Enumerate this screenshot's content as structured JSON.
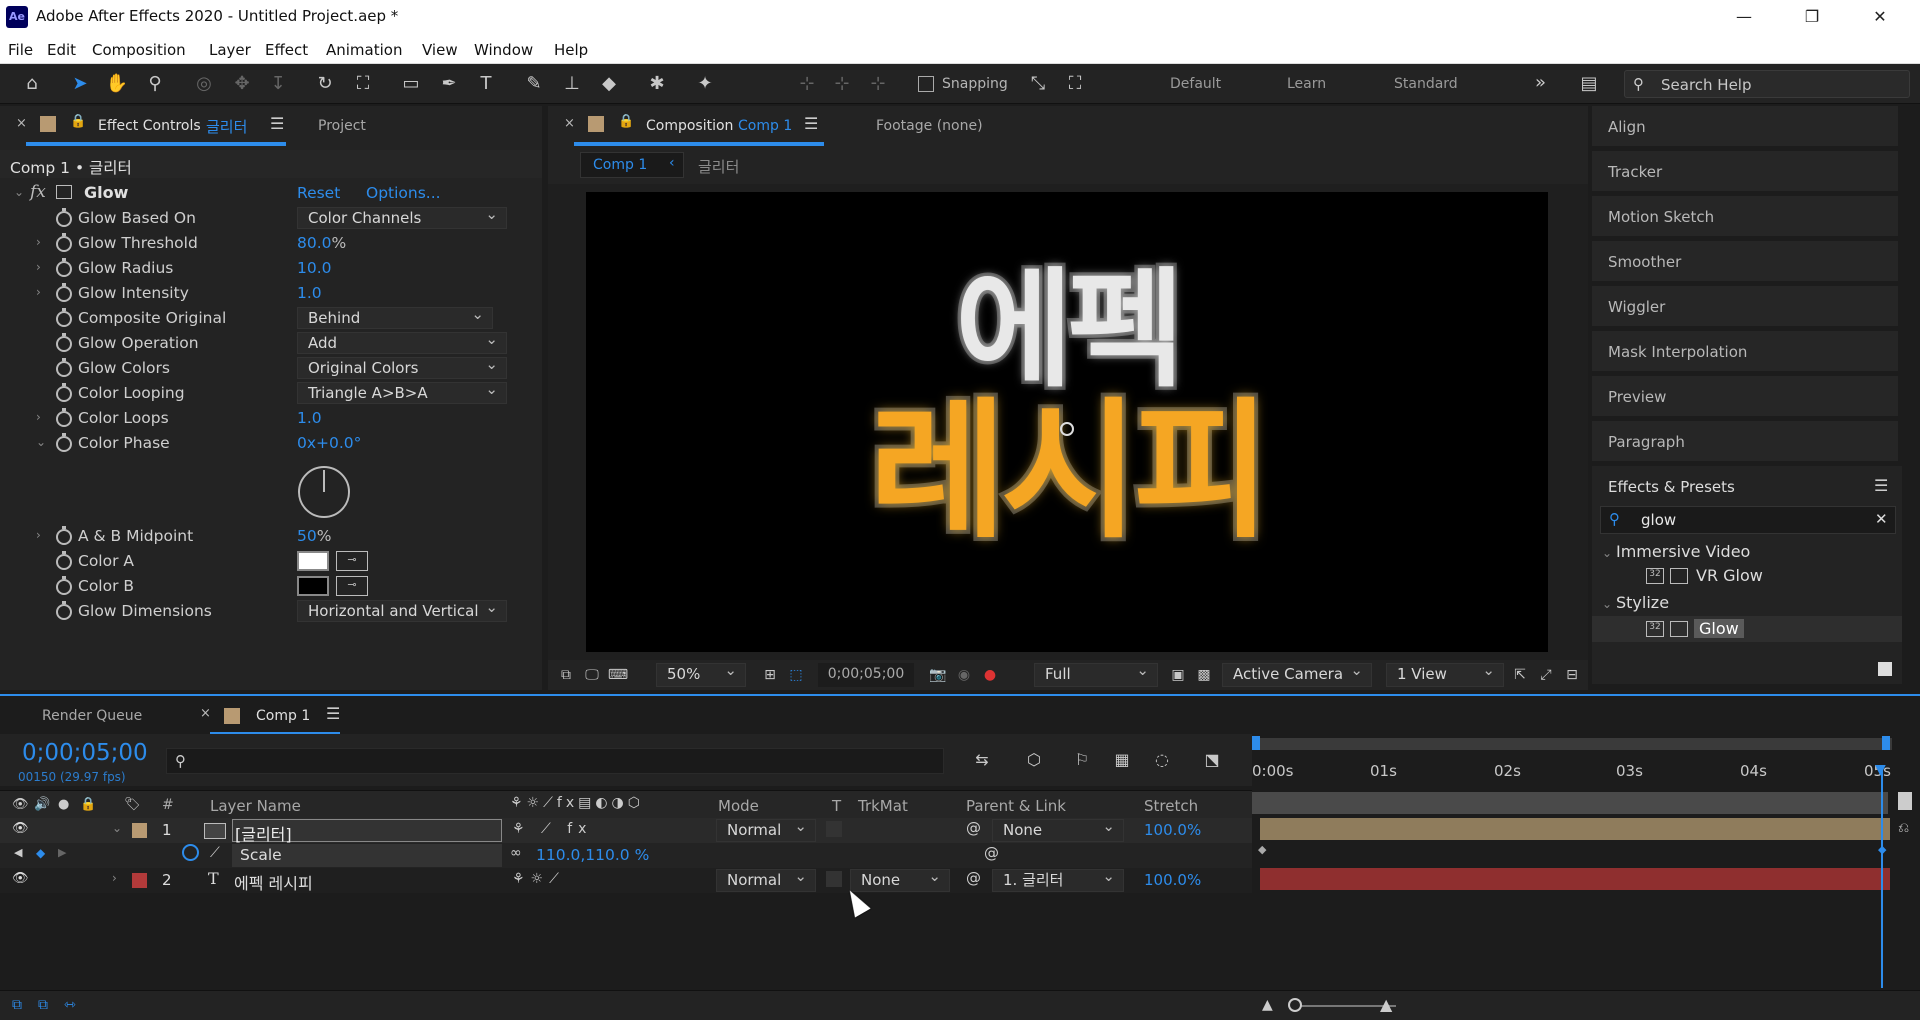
{
  "window": {
    "title": "Adobe After Effects 2020 - Untitled Project.aep *",
    "logo": "Ae",
    "controls": [
      "minimize-icon",
      "restore-icon",
      "close-icon"
    ]
  },
  "menu": [
    "File",
    "Edit",
    "Composition",
    "Layer",
    "Effect",
    "Animation",
    "View",
    "Window",
    "Help"
  ],
  "toolbar": {
    "snapping": "Snapping",
    "workspaces": [
      "Default",
      "Learn",
      "Standard"
    ],
    "more": "»",
    "search_placeholder": "Search Help"
  },
  "effect_controls": {
    "tab_label": "Effect Controls",
    "tab_layer": "글리터",
    "project_tab": "Project",
    "breadcrumb": "Comp 1 • 글리터",
    "effect_name": "Glow",
    "reset": "Reset",
    "options": "Options...",
    "props": [
      {
        "label": "Glow Based On",
        "type": "dropdown",
        "value": "Color Channels"
      },
      {
        "label": "Glow Threshold",
        "type": "number",
        "value": "80.0",
        "unit": "%"
      },
      {
        "label": "Glow Radius",
        "type": "number",
        "value": "10.0"
      },
      {
        "label": "Glow Intensity",
        "type": "number",
        "value": "1.0"
      },
      {
        "label": "Composite Original",
        "type": "dropdown",
        "value": "Behind"
      },
      {
        "label": "Glow Operation",
        "type": "dropdown",
        "value": "Add"
      },
      {
        "label": "Glow Colors",
        "type": "dropdown",
        "value": "Original Colors"
      },
      {
        "label": "Color Looping",
        "type": "dropdown",
        "value": "Triangle A>B>A"
      },
      {
        "label": "Color Loops",
        "type": "number",
        "value": "1.0"
      },
      {
        "label": "Color Phase",
        "type": "angle",
        "value": "0x+0.0°"
      }
    ],
    "props2": [
      {
        "label": "A & B Midpoint",
        "value": "50",
        "unit": "%"
      },
      {
        "label": "Color A",
        "color": "#ffffff"
      },
      {
        "label": "Color B",
        "color": "#000000"
      },
      {
        "label": "Glow Dimensions",
        "value": "Horizontal and Vertical"
      }
    ]
  },
  "composition": {
    "tab_label": "Composition",
    "tab_comp": "Comp 1",
    "footage_tab": "Footage  (none)",
    "crumb_active": "Comp 1",
    "crumb_next": "글리터",
    "title_line1": "에펙",
    "title_line2": "레시피",
    "footer": {
      "zoom": "50%",
      "timecode": "0;00;05;00",
      "resolution": "Full",
      "camera": "Active Camera",
      "views": "1 View"
    }
  },
  "right_panels": [
    "Align",
    "Tracker",
    "Motion Sketch",
    "Smoother",
    "Wiggler",
    "Mask Interpolation",
    "Preview",
    "Paragraph"
  ],
  "effects_presets": {
    "title": "Effects & Presets",
    "search_value": "glow",
    "groups": [
      {
        "name": "Immersive Video",
        "items": [
          "VR Glow"
        ]
      },
      {
        "name": "Stylize",
        "items": [
          "Glow"
        ]
      }
    ]
  },
  "timeline": {
    "render_tab": "Render Queue",
    "comp_tab": "Comp 1",
    "timecode": "0;00;05;00",
    "fps": "00150 (29.97 fps)",
    "columns": {
      "num": "#",
      "layer_name": "Layer Name",
      "mode": "Mode",
      "t": "T",
      "trkmat": "TrkMat",
      "parent": "Parent & Link",
      "stretch": "Stretch"
    },
    "ruler": [
      "0:00s",
      "01s",
      "02s",
      "03s",
      "04s",
      "05s"
    ],
    "layers": [
      {
        "num": "1",
        "name": "[글리터]",
        "mode": "Normal",
        "trkmat": "",
        "parent": "None",
        "stretch": "100.0%",
        "color": "#b89a72",
        "type": "precomp"
      },
      {
        "num": "2",
        "name": "에펙 레시피",
        "mode": "Normal",
        "trkmat": "None",
        "parent": "1. 글리터",
        "stretch": "100.0%",
        "color": "#b23a3a",
        "type": "text"
      }
    ],
    "scale_prop": {
      "label": "Scale",
      "value": "110.0,110.0 %"
    }
  }
}
